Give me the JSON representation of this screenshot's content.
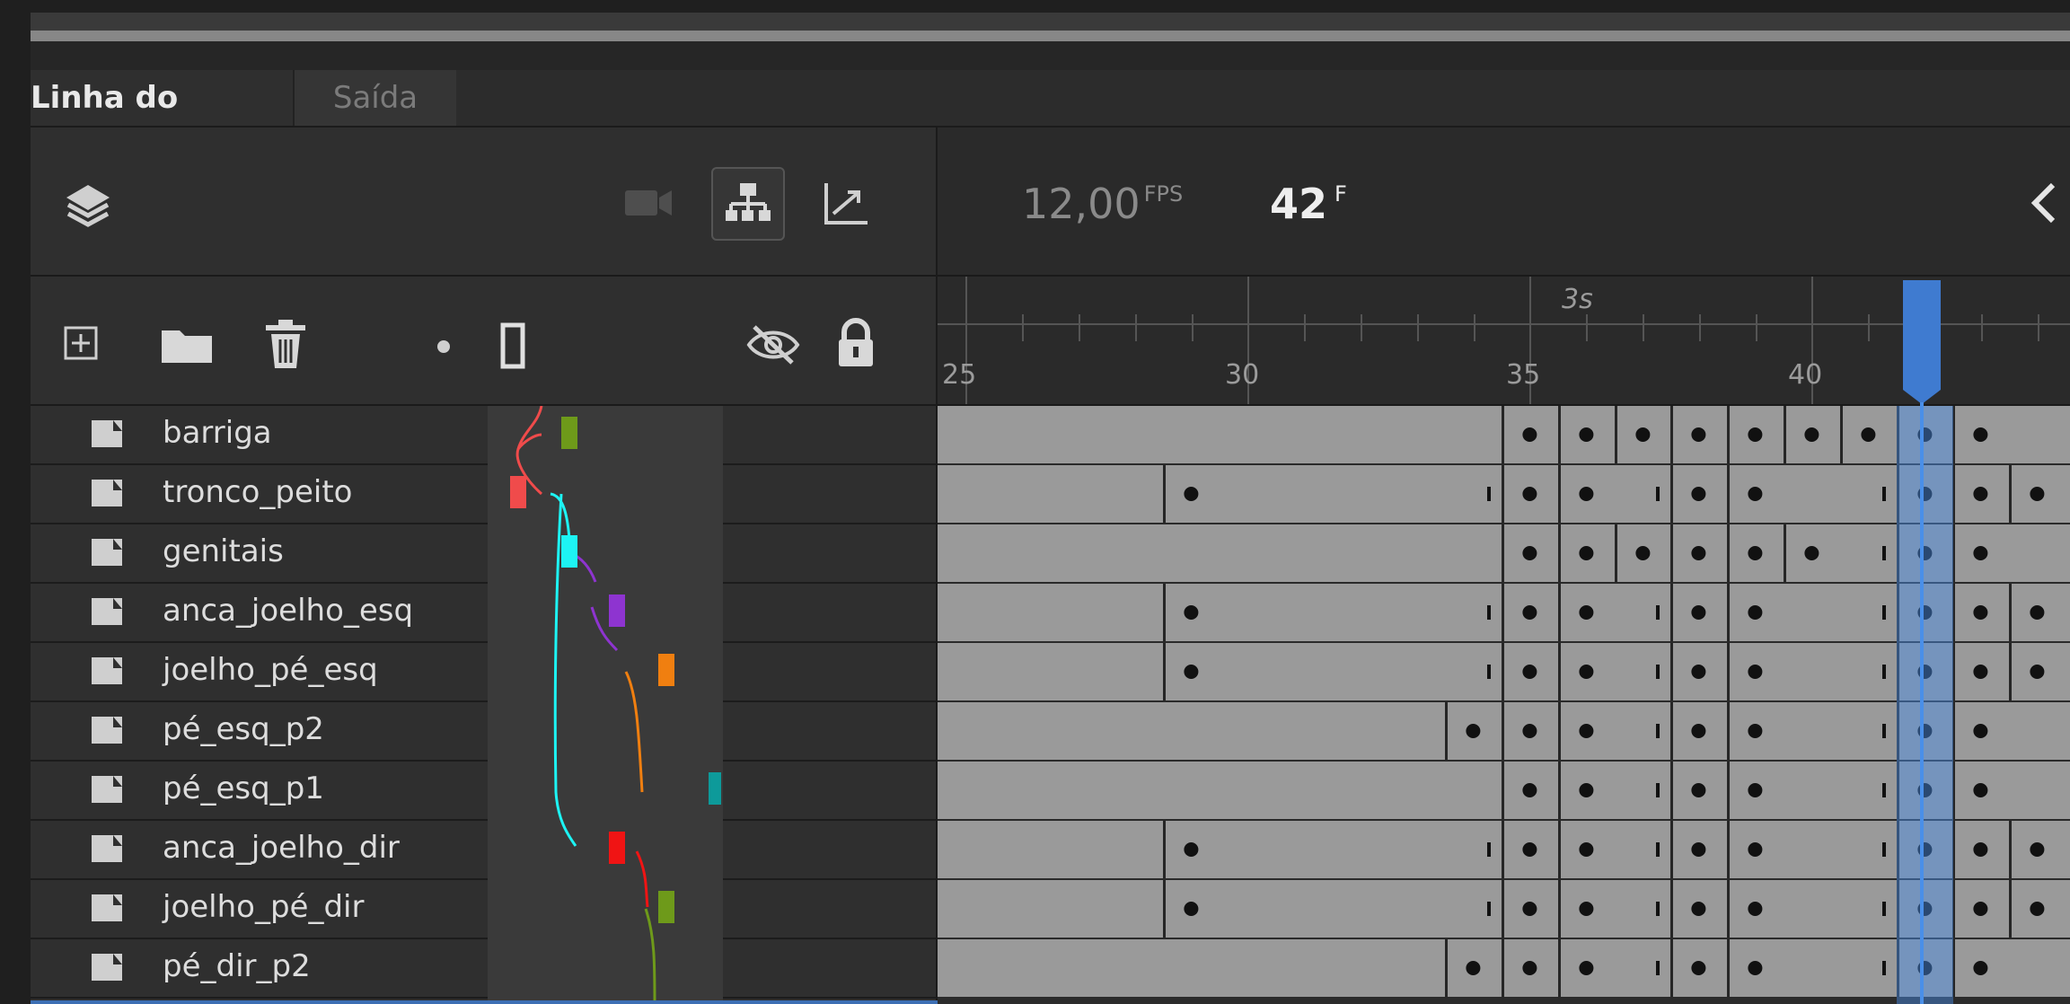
{
  "tabs": {
    "timeline": "Linha do tempo",
    "output": "Saída"
  },
  "toolbar": {
    "fps_value": "12,00",
    "fps_unit": "FPS",
    "frame_value": "42",
    "frame_unit": "F",
    "icons": [
      "layers-icon",
      "camera-icon",
      "layer-parenting-icon",
      "graph-icon",
      "chevron-left-icon"
    ]
  },
  "layer_tools": {
    "icons": [
      "new-layer-icon",
      "new-folder-icon",
      "delete-icon",
      "dot-icon",
      "outline-icon",
      "visibility-off-icon",
      "lock-icon"
    ]
  },
  "ruler": {
    "second_marker": "3s",
    "frame_numbers": [
      "25",
      "30",
      "35",
      "40"
    ],
    "current_frame": 42
  },
  "layers": [
    {
      "name": "barriga",
      "color": "#6e9a1a"
    },
    {
      "name": "tronco_peito",
      "color": "#f04b4b"
    },
    {
      "name": "genitais",
      "color": "#1df4f4"
    },
    {
      "name": "anca_joelho_esq",
      "color": "#8e34d0"
    },
    {
      "name": "joelho_pé_esq",
      "color": "#f07f10"
    },
    {
      "name": "pé_esq_p2",
      "color": "#4aa7a7"
    },
    {
      "name": "pé_esq_p1",
      "color": "#0d9a9a"
    },
    {
      "name": "anca_joelho_dir",
      "color": "#f01414"
    },
    {
      "name": "joelho_pé_dir",
      "color": "#6e9a1a"
    },
    {
      "name": "pé_dir_p2",
      "color": "#6e9a1a"
    }
  ],
  "keyframe_rows": [
    [
      35,
      36,
      37,
      38,
      39,
      40,
      41,
      42,
      43
    ],
    [
      29,
      35,
      36,
      38,
      39,
      42,
      43,
      44
    ],
    [
      35,
      36,
      37,
      38,
      39,
      40,
      42,
      43
    ],
    [
      29,
      35,
      36,
      38,
      39,
      42,
      43,
      44
    ],
    [
      29,
      35,
      36,
      38,
      39,
      42,
      43,
      44
    ],
    [
      34,
      35,
      36,
      38,
      39,
      42,
      43
    ],
    [
      35,
      36,
      38,
      39,
      42,
      43
    ],
    [
      29,
      35,
      36,
      38,
      39,
      42,
      43,
      44
    ],
    [
      29,
      35,
      36,
      38,
      39,
      42,
      43,
      44
    ],
    [
      34,
      35,
      36,
      38,
      39,
      42,
      43
    ]
  ]
}
